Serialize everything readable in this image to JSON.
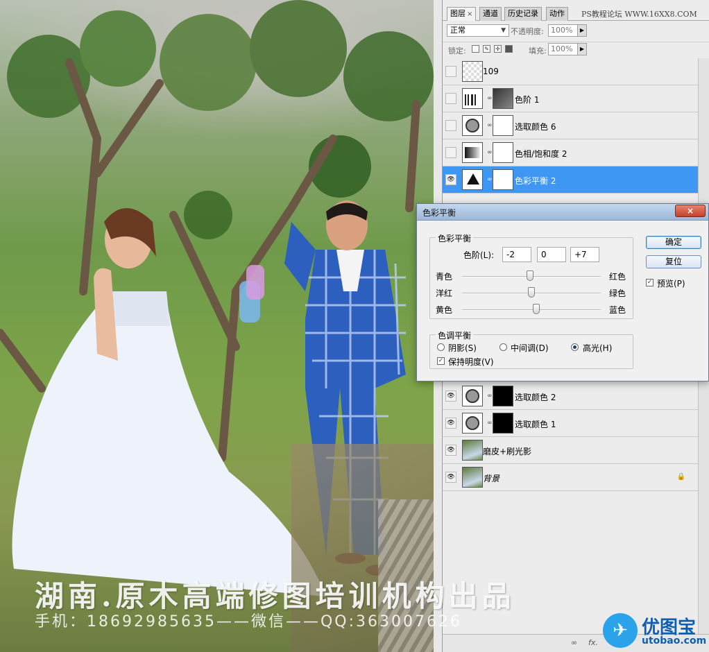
{
  "panel": {
    "tabs": [
      {
        "label": "图层",
        "close": "×"
      },
      {
        "label": "通道"
      },
      {
        "label": "历史记录"
      },
      {
        "label": "动作"
      }
    ],
    "watermark": "PS教程论坛 WWW.16XX8.COM",
    "blend_mode": "正常",
    "opacity_label": "不透明度:",
    "opacity_value": "100%",
    "lock_label": "锁定:",
    "fill_label": "填充:",
    "fill_value": "100%",
    "layers": [
      {
        "name": "109",
        "visible": false
      },
      {
        "name": "色阶 1",
        "visible": false
      },
      {
        "name": "选取颜色 6",
        "visible": false
      },
      {
        "name": "色相/饱和度 2",
        "visible": false
      },
      {
        "name": "色彩平衡 2",
        "visible": true,
        "selected": true
      },
      {
        "name": "选取颜色 2",
        "visible": true
      },
      {
        "name": "选取颜色 1",
        "visible": true
      },
      {
        "name": "磨皮+刷光影",
        "visible": true
      },
      {
        "name": "背景",
        "visible": true,
        "locked": true
      }
    ]
  },
  "dialog": {
    "title": "色彩平衡",
    "close": "×",
    "balance_group": "色彩平衡",
    "levels_label": "色阶(L):",
    "levels": [
      "-2",
      "0",
      "+7"
    ],
    "sliders": [
      {
        "left": "青色",
        "right": "红色",
        "value": -2
      },
      {
        "left": "洋红",
        "right": "绿色",
        "value": 0
      },
      {
        "left": "黄色",
        "right": "蓝色",
        "value": 7
      }
    ],
    "tone_group": "色调平衡",
    "tones": [
      {
        "label": "阴影(S)",
        "selected": false
      },
      {
        "label": "中间调(D)",
        "selected": false
      },
      {
        "label": "高光(H)",
        "selected": true
      }
    ],
    "preserve_luminosity": "保持明度(V)",
    "ok": "确定",
    "reset": "复位",
    "preview": "预览(P)"
  },
  "overlay": {
    "title_line": "湖南.原木高端修图培训机构出品",
    "contact_line": "手机：18692985635——微信——QQ:363007626",
    "logo_name": "优图宝",
    "logo_url": "utobao.com"
  }
}
